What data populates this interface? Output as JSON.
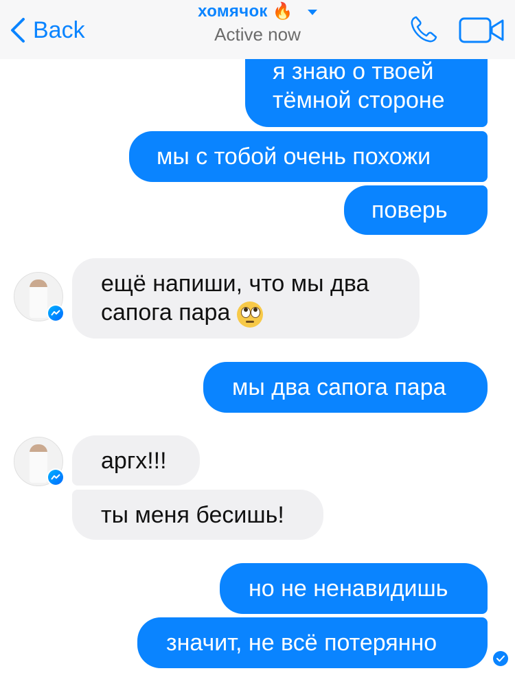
{
  "header": {
    "back_label": "Back",
    "contact_name": "хомячок",
    "contact_emoji": "🔥",
    "status": "Active now",
    "icons": [
      "chevron-left-icon",
      "chevron-down-icon",
      "phone-icon",
      "video-camera-icon"
    ]
  },
  "messages": [
    {
      "dir": "out",
      "text_line1": "я знаю о твоей",
      "text_line2": "тёмной стороне"
    },
    {
      "dir": "out",
      "text": "мы с тобой очень похожи"
    },
    {
      "dir": "out",
      "text": "поверь"
    },
    {
      "dir": "in",
      "text_line1": "ещё напиши, что мы два",
      "text_line2": "сапога пара",
      "emoji": "face-with-rolling-eyes"
    },
    {
      "dir": "out",
      "text": "мы два сапога пара"
    },
    {
      "dir": "in",
      "text": "аргх!!!"
    },
    {
      "dir": "in",
      "text": "ты меня бесишь!"
    },
    {
      "dir": "out",
      "text": "но не ненавидишь"
    },
    {
      "dir": "out",
      "text": "значит, не всё потерянно"
    }
  ],
  "colors": {
    "accent": "#0a84ff",
    "incoming_bubble": "#f0f0f2",
    "header_bg": "#f7f7f8"
  }
}
